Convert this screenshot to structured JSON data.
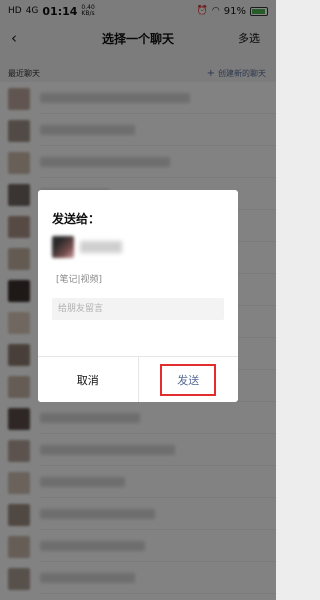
{
  "status_bar": {
    "carrier_1": "HD",
    "carrier_2": "4G",
    "time": "01:14",
    "speed_value": "0.40",
    "speed_unit": "KB/s",
    "battery_percent": "91%",
    "battery_level": 0.91
  },
  "header": {
    "back_icon": "back-arrow-icon",
    "title": "选择一个聊天",
    "multi_select": "多选"
  },
  "section": {
    "recent_label": "最近聊天",
    "create_chat": "创建新的聊天",
    "plus_icon": "plus-icon"
  },
  "chat_list": {
    "count": 16
  },
  "dialog": {
    "title": "发送给：",
    "content_label": "[笔记|视频]",
    "input_placeholder": "给朋友留言",
    "cancel_label": "取消",
    "send_label": "发送"
  },
  "colors": {
    "link": "#576b95",
    "highlight_border": "#e22d2d",
    "overlay": "rgba(0,0,0,0.48)"
  }
}
